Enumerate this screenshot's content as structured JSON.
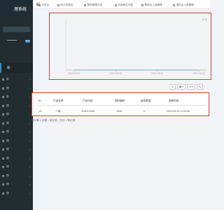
{
  "sidebar": {
    "brand": "理系统",
    "badge": "NEW",
    "active_label": "理",
    "items": [
      "表",
      "理",
      "表",
      "理",
      "理",
      "理",
      "理",
      "理",
      "理",
      "理",
      "理",
      "理",
      "理",
      "理"
    ]
  },
  "tabs": [
    "控制台",
    "统计控制台",
    "物料管理记录",
    "仓库单位列表",
    "移库出入库管理",
    "退料出入库管理"
  ],
  "chart": {
    "tools_label": "⊞ ⬇",
    "x_labels": [
      "2024-09-07",
      "2024-09-09",
      "2024-09-11",
      "2024-09-12"
    ]
  },
  "chart_data": {
    "type": "line",
    "x": [
      "2024-09-07",
      "2024-09-09",
      "2024-09-11",
      "2024-09-12"
    ],
    "series": [
      {
        "values": [
          0,
          0,
          0,
          0
        ]
      }
    ],
    "xlabel": "",
    "ylabel": "",
    "grid": true
  },
  "toolbar": {
    "refresh": "⊟",
    "columns": "▦ ▾",
    "export": "⇲ ▾",
    "search": "🔍"
  },
  "table": {
    "headers": [
      "ID",
      "产品名称",
      "产品代码",
      "物料编码",
      "库存数量",
      "更新时间"
    ],
    "rows": [
      [
        "15",
        "一期",
        "TLWS-1506",
        "1506",
        "0",
        "2024-09-20 11:53:46"
      ]
    ]
  },
  "pager_text": "显示第 1 到第 1 条记录，总共 1 条记录"
}
